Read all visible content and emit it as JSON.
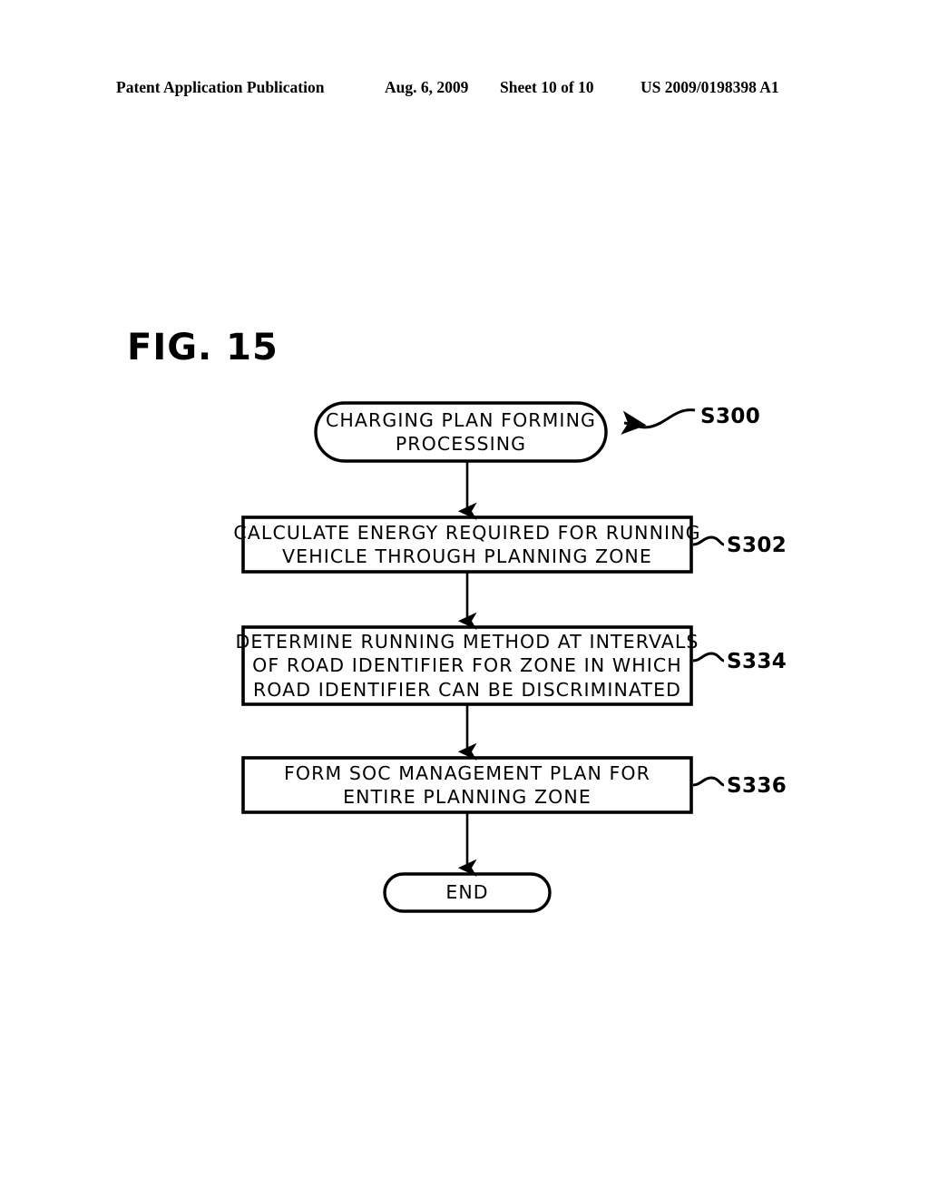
{
  "page": {
    "header": {
      "publication": "Patent Application Publication",
      "date": "Aug. 6, 2009",
      "sheet": "Sheet 10 of 10",
      "patent_number": "US 2009/0198398 A1"
    },
    "figure_label": "FIG. 15"
  },
  "flowchart": {
    "title": "CHARGING PLAN FORMING PROCESSING",
    "nodes": [
      {
        "id": "S300",
        "shape": "terminal",
        "lines": [
          "CHARGING PLAN FORMING",
          "PROCESSING"
        ]
      },
      {
        "id": "S302",
        "shape": "process",
        "lines": [
          "CALCULATE ENERGY REQUIRED FOR RUNNING",
          "VEHICLE THROUGH PLANNING ZONE"
        ]
      },
      {
        "id": "S334",
        "shape": "process",
        "lines": [
          "DETERMINE RUNNING METHOD AT INTERVALS",
          "OF ROAD IDENTIFIER FOR ZONE IN WHICH",
          "ROAD IDENTIFIER CAN BE DISCRIMINATED"
        ]
      },
      {
        "id": "S336",
        "shape": "process",
        "lines": [
          "FORM SOC MANAGEMENT PLAN FOR",
          "ENTIRE PLANNING ZONE"
        ]
      },
      {
        "id": "END",
        "shape": "terminal",
        "lines": [
          "END"
        ]
      }
    ],
    "step_labels": {
      "s300": "S300",
      "s302": "S302",
      "s334": "S334",
      "s336": "S336"
    },
    "colors": {
      "stroke": "#000000",
      "fill": "#ffffff",
      "text": "#000000"
    }
  }
}
